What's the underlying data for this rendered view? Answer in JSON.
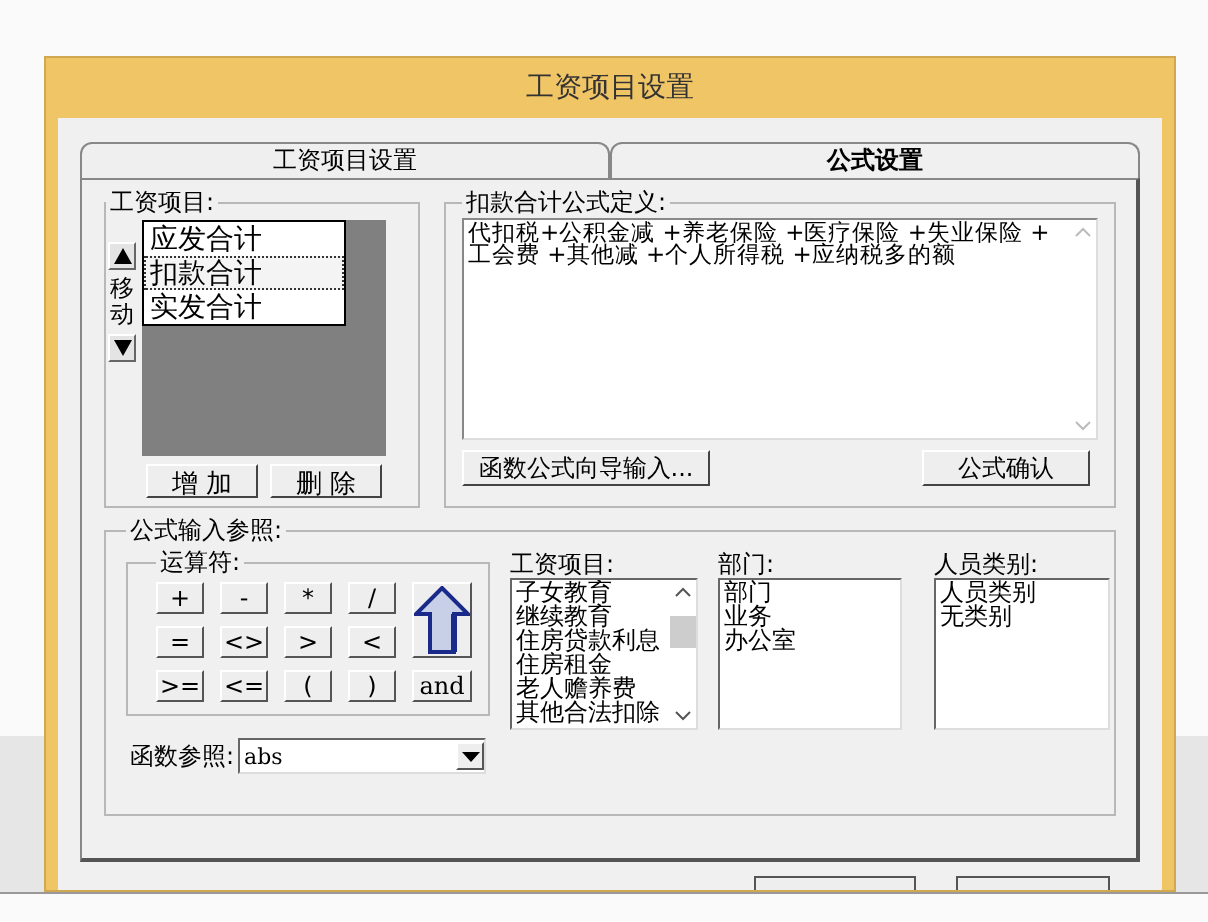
{
  "window": {
    "title": "工资项目设置"
  },
  "tabs": [
    {
      "label": "工资项目设置",
      "selected": false
    },
    {
      "label": "公式设置",
      "selected": true
    }
  ],
  "salary_items": {
    "label": "工资项目:",
    "items": [
      {
        "text": "应发合计",
        "selected": false
      },
      {
        "text": "扣款合计",
        "selected": true
      },
      {
        "text": "实发合计",
        "selected": false
      }
    ],
    "move_label": "移动",
    "buttons": [
      "增 加",
      "删 除"
    ]
  },
  "formula": {
    "label": "扣款合计公式定义:",
    "lines": [
      "代扣税+公积金减 +养老保险 +医疗保险 +失业保险 +",
      "工会费 +其他减 +个人所得税 +应纳税多的额"
    ],
    "wizard_button": "函数公式向导输入...",
    "confirm_button": "公式确认"
  },
  "reference": {
    "label": "公式输入参照:",
    "operators_label": "运算符:",
    "operators": [
      "+",
      "-",
      "*",
      "/",
      "=",
      "<>",
      ">",
      "<",
      ">=",
      "<=",
      "(",
      ")"
    ],
    "and_key": "and",
    "function_label": "函数参照:",
    "function_value": "abs",
    "lists": [
      {
        "label": "工资项目:",
        "scrollbar": true,
        "items": [
          "子女教育",
          "继续教育",
          "住房贷款利息",
          "住房租金",
          "老人赡养费",
          "其他合法扣除"
        ]
      },
      {
        "label": "部门:",
        "scrollbar": false,
        "items": [
          "部门",
          "业务",
          "办公室"
        ]
      },
      {
        "label": "人员类别:",
        "scrollbar": false,
        "items": [
          "人员类别",
          "无类别"
        ]
      }
    ]
  }
}
